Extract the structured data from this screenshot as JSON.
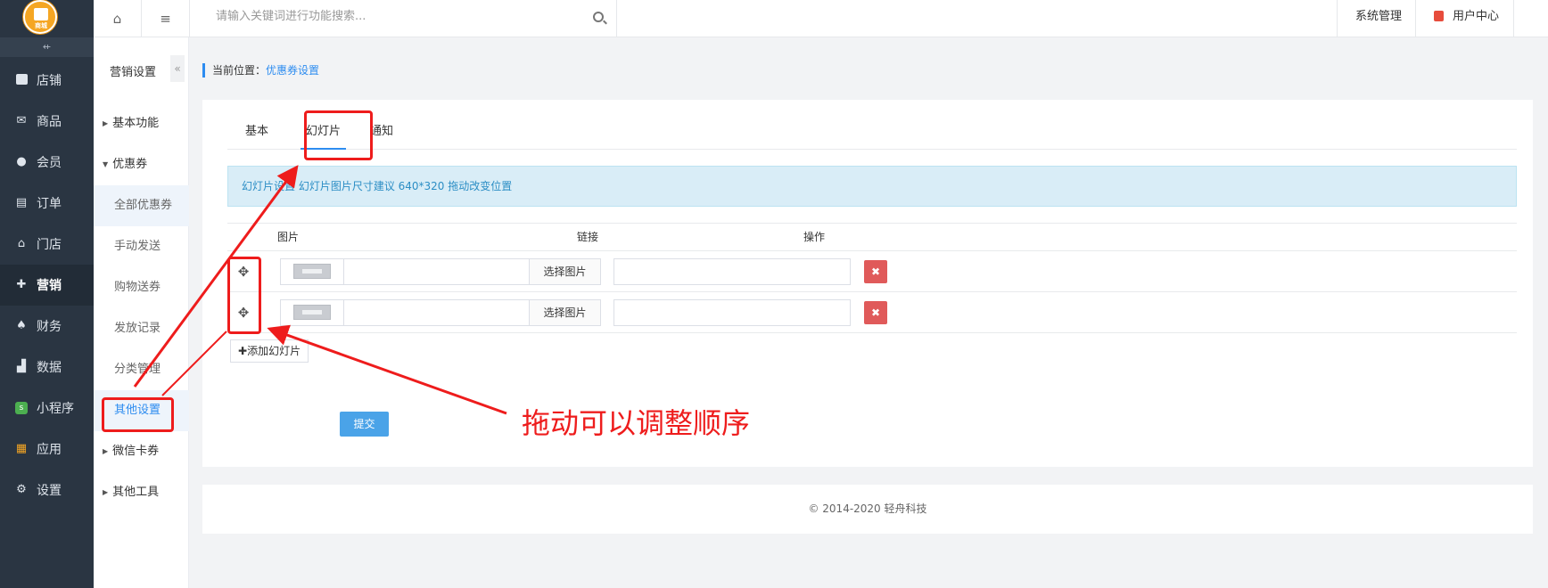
{
  "logo": {
    "caption": "商城"
  },
  "nav": [
    {
      "label": "店铺",
      "icon": "shop-icon"
    },
    {
      "label": "商品",
      "icon": "goods-icon"
    },
    {
      "label": "会员",
      "icon": "user-icon"
    },
    {
      "label": "订单",
      "icon": "order-icon"
    },
    {
      "label": "门店",
      "icon": "store-icon"
    },
    {
      "label": "营销",
      "icon": "gift-icon"
    },
    {
      "label": "财务",
      "icon": "money-bag-icon"
    },
    {
      "label": "数据",
      "icon": "bar-chart-icon"
    },
    {
      "label": "小程序",
      "icon": "mini-program-icon"
    },
    {
      "label": "应用",
      "icon": "apps-icon"
    },
    {
      "label": "设置",
      "icon": "gear-icon"
    }
  ],
  "sub": {
    "title": "营销设置",
    "groups": [
      "基本功能",
      "优惠券",
      "微信卡券",
      "其他工具"
    ],
    "children": [
      "全部优惠券",
      "手动发送",
      "购物送券",
      "发放记录",
      "分类管理",
      "其他设置"
    ]
  },
  "topbar": {
    "search_placeholder": "请输入关键词进行功能搜索...",
    "system": "系统管理",
    "user_center": "用户中心"
  },
  "breadcrumb": {
    "prefix": "当前位置：",
    "current": "优惠券设置"
  },
  "tabs": [
    "基本",
    "幻灯片",
    "通知"
  ],
  "notice": "幻灯片设置 幻灯片图片尺寸建议 640*320 拖动改变位置",
  "table": {
    "headers": [
      "图片",
      "链接",
      "操作"
    ],
    "pick_label": "选择图片",
    "rows": [
      {
        "link": ""
      },
      {
        "link": ""
      }
    ]
  },
  "add_slide": "添加幻灯片",
  "submit": "提交",
  "footer": "© 2014-2020 轻舟科技",
  "annotation": {
    "text": "拖动可以调整顺序",
    "color": "#ee1c1c"
  },
  "colors": {
    "accent": "#2d8cf0",
    "sidebar": "#2a3542",
    "danger": "#e05a5a"
  }
}
